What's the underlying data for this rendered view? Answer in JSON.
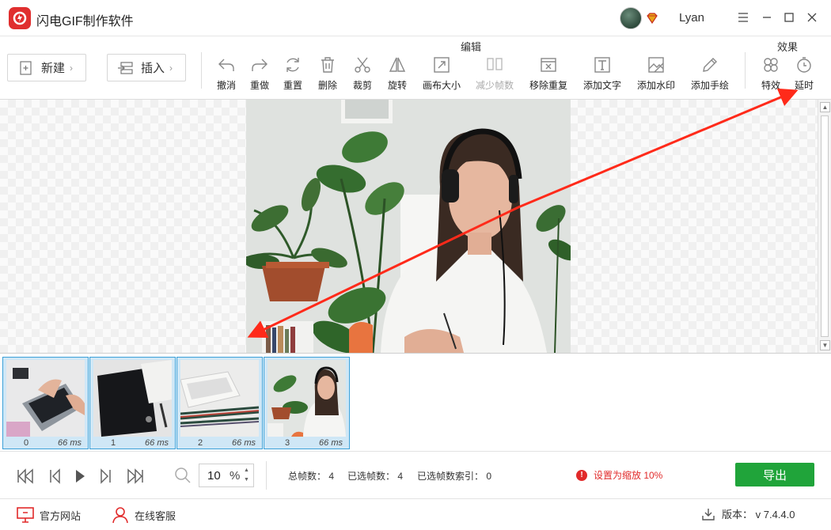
{
  "app": {
    "title": "闪电GIF制作软件",
    "username": "Lyan"
  },
  "toolbar": {
    "new_label": "新建",
    "insert_label": "插入",
    "edit_group_label": "编辑",
    "effects_group_label": "效果",
    "tools": [
      {
        "label": "撤消",
        "icon": "undo-icon",
        "enabled": true
      },
      {
        "label": "重做",
        "icon": "redo-icon",
        "enabled": true
      },
      {
        "label": "重置",
        "icon": "reset-icon",
        "enabled": true
      },
      {
        "label": "删除",
        "icon": "trash-icon",
        "enabled": true
      },
      {
        "label": "裁剪",
        "icon": "scissors-icon",
        "enabled": true
      },
      {
        "label": "旋转",
        "icon": "rotate-icon",
        "enabled": true
      },
      {
        "label": "画布大小",
        "icon": "canvas-size-icon",
        "enabled": true
      },
      {
        "label": "减少帧数",
        "icon": "reduce-frames-icon",
        "enabled": false
      },
      {
        "label": "移除重复",
        "icon": "remove-duplicate-icon",
        "enabled": true
      },
      {
        "label": "添加文字",
        "icon": "text-icon",
        "enabled": true
      },
      {
        "label": "添加水印",
        "icon": "watermark-icon",
        "enabled": true
      },
      {
        "label": "添加手绘",
        "icon": "pen-icon",
        "enabled": true
      }
    ],
    "effect_tools": [
      {
        "label": "特效",
        "icon": "effects-icon"
      },
      {
        "label": "延时",
        "icon": "timer-icon"
      }
    ]
  },
  "frames": [
    {
      "index": "0",
      "duration": "66 ms",
      "scene": "laptop typing"
    },
    {
      "index": "1",
      "duration": "66 ms",
      "scene": "drawing tablet"
    },
    {
      "index": "2",
      "duration": "66 ms",
      "scene": "keyboard and pencils"
    },
    {
      "index": "3",
      "duration": "66 ms",
      "scene": "girl with headphones"
    }
  ],
  "playback": {
    "zoom_value": "10",
    "zoom_unit": "%",
    "total_frames": "总帧数：  4",
    "selected_frames": "已选帧数：  4",
    "selected_index": "已选帧数索引：  0",
    "warning": "设置为缩放 10%",
    "export_label": "导出"
  },
  "footer": {
    "website_label": "官方网站",
    "support_label": "在线客服",
    "version_label": "版本：  v 7.4.4.0"
  },
  "colors": {
    "brand_red": "#e02f2f",
    "export_green": "#20a43a",
    "selection_blue": "#3aa0d8",
    "arrow_red": "#ff2a1a"
  }
}
